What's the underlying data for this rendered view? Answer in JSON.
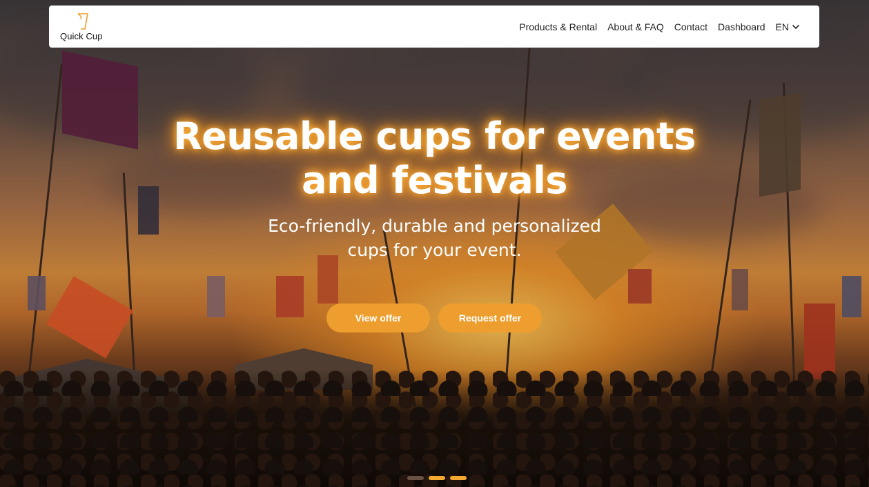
{
  "brand": {
    "name": "Quick Cup",
    "accent_color": "#ee9e2e"
  },
  "nav": {
    "items": [
      {
        "label": "Products & Rental"
      },
      {
        "label": "About & FAQ"
      },
      {
        "label": "Contact"
      },
      {
        "label": "Dashboard"
      }
    ],
    "language": {
      "label": "EN",
      "icon": "chevron-down-icon"
    }
  },
  "hero": {
    "headline_line1": "Reusable cups for events",
    "headline_line2": "and festivals",
    "subline_line1": "Eco-friendly, durable and personalized",
    "subline_line2": "cups for your event.",
    "buttons": {
      "view_offer": "View offer",
      "request_offer": "Request offer"
    }
  },
  "carousel": {
    "slide_count": 3,
    "active_indices": [
      1,
      2
    ],
    "dot_colors": {
      "inactive": "#6b5144",
      "active": "#f3a92f"
    }
  }
}
